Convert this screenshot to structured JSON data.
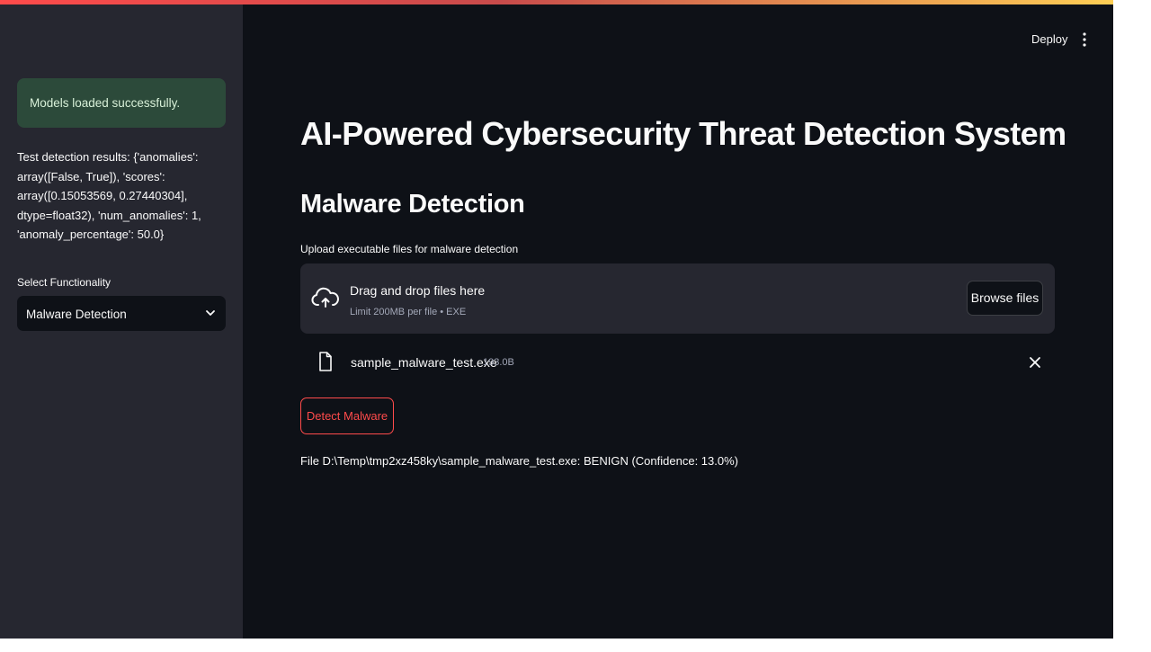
{
  "header": {
    "deploy_label": "Deploy",
    "menu_icon": "kebab-menu-icon"
  },
  "sidebar": {
    "success_message": "Models loaded successfully.",
    "test_results": "Test detection results: {'anomalies':\narray([False, True]), 'scores':\narray([0.15053569, 0.27440304],\ndtype=float32), 'num_anomalies': 1,\n'anomaly_percentage': 50.0}",
    "select_label": "Select Functionality",
    "selected_option": "Malware Detection"
  },
  "main": {
    "title": "AI-Powered Cybersecurity Threat Detection System",
    "section_title": "Malware Detection",
    "uploader_label": "Upload executable files for malware detection",
    "dropzone": {
      "title": "Drag and drop files here",
      "limit": "Limit 200MB per file • EXE",
      "browse_label": "Browse files"
    },
    "uploaded_file": {
      "name": "sample_malware_test.exe",
      "size": "193.0B"
    },
    "detect_label": "Detect Malware",
    "result": "File D:\\Temp\\tmp2xz458ky\\sample_malware_test.exe: BENIGN (Confidence: 13.0%)"
  },
  "colors": {
    "background": "#0e1117",
    "sidebar": "#262730",
    "success_bg": "#2c4a3a",
    "accent": "#ff4b4b"
  }
}
